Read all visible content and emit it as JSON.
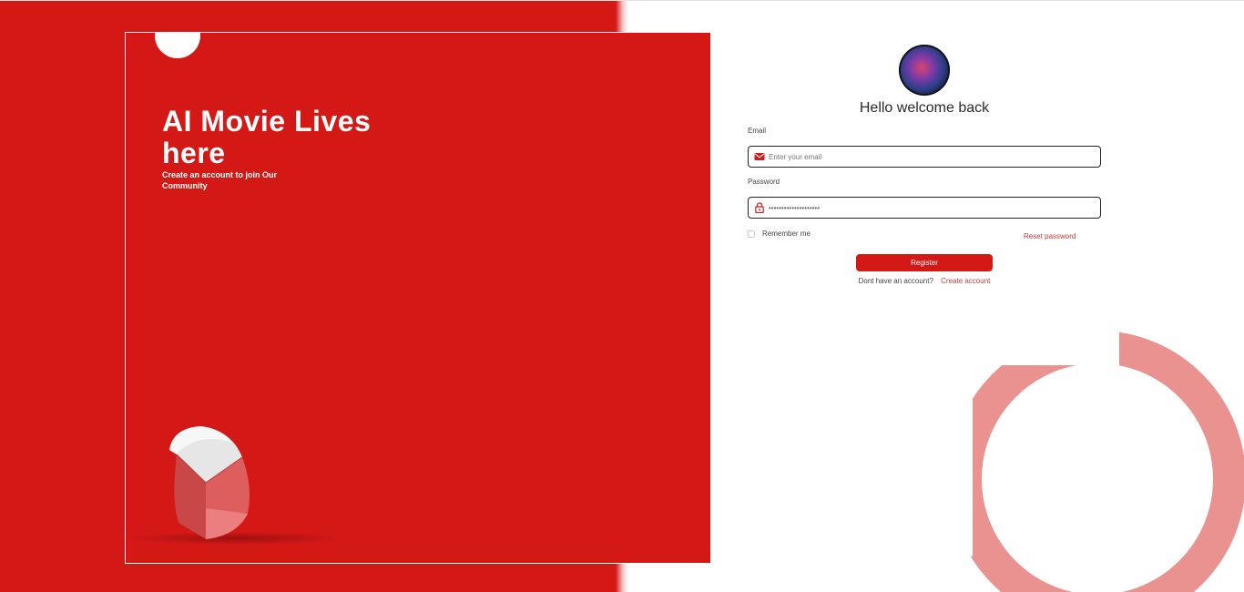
{
  "hero": {
    "title": "AI Movie Lives here",
    "subtitle": "Create an account to join Our Community",
    "logo_icon": "pie-chart-3d-icon",
    "background_color": "#d41816"
  },
  "login": {
    "avatar_icon": "galaxy-avatar",
    "heading": "Hello welcome back",
    "email": {
      "label": "Email",
      "placeholder": "Enter your email",
      "value": "",
      "icon": "mail-icon"
    },
    "password": {
      "label": "Password",
      "value": "••••••••••••••••••••",
      "icon": "lock-icon"
    },
    "remember_label": "Remember me",
    "remember_checked": false,
    "reset_label": "Reset password",
    "register_label": "Register",
    "signup_text": "Dont have an account?",
    "signup_link": "Create account"
  },
  "colors": {
    "accent": "#d41816",
    "link": "#c43a3a",
    "ring": "#e99290"
  }
}
